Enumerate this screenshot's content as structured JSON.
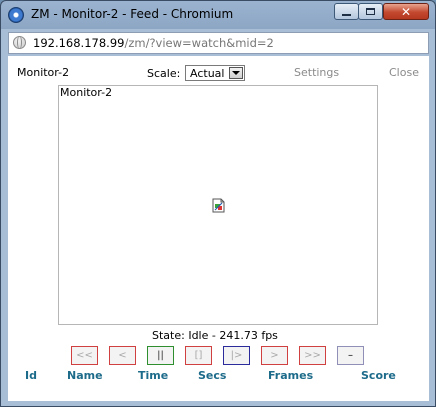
{
  "window": {
    "title": "ZM - Monitor-2 - Feed - Chromium",
    "minimize_glyph": "",
    "close_glyph": "✕"
  },
  "address": {
    "host": "192.168.178.99",
    "path": "/zm/?view=watch&mid=2"
  },
  "header": {
    "monitor_name": "Monitor-2",
    "scale_label": "Scale:",
    "scale_value": "Actual",
    "settings_label": "Settings",
    "close_label": "Close"
  },
  "feed": {
    "overlay_title": "Monitor-2",
    "image_icon": "broken-image-icon"
  },
  "status": {
    "text": "State: Idle - 241.73 fps"
  },
  "controls": [
    {
      "label": "<<"
    },
    {
      "label": "<"
    },
    {
      "label": "||"
    },
    {
      "label": "[]"
    },
    {
      "label": "|>"
    },
    {
      "label": ">"
    },
    {
      "label": ">>"
    },
    {
      "label": "–"
    }
  ],
  "stats": {
    "id": "Id",
    "name": "Name",
    "time": "Time",
    "secs": "Secs",
    "frames": "Frames",
    "score": "Score"
  }
}
